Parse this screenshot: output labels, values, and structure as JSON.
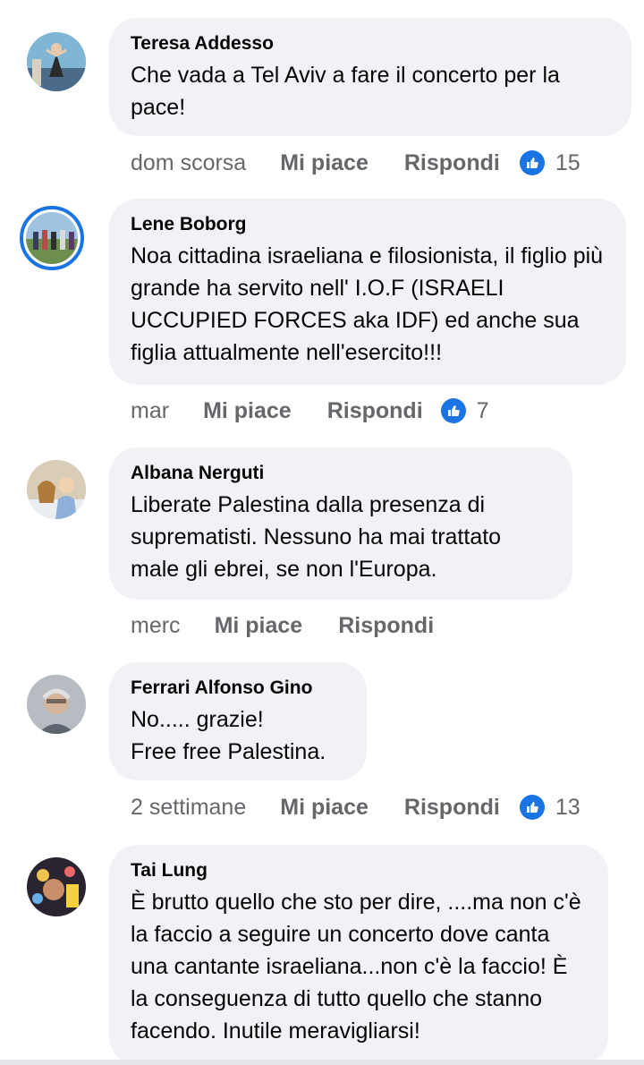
{
  "colors": {
    "bubble": "#f0f2f5",
    "meta_text": "#65676b",
    "like_blue": "#1b74e4"
  },
  "comments": [
    {
      "author": "Teresa Addesso",
      "text": "Che vada a Tel Aviv a fare il concerto per la pace!",
      "time": "dom scorsa",
      "like_label": "Mi piace",
      "reply_label": "Rispondi",
      "reaction_icon": "thumbs-up-icon",
      "reactions": "15"
    },
    {
      "author": "Lene Boborg",
      "text": "Noa cittadina israeliana e filosionista, il figlio più grande ha servito nell' I.O.F (ISRAELI UCCUPIED FORCES aka IDF) ed anche sua figlia attualmente nell'esercito!!!",
      "time": "mar",
      "like_label": "Mi piace",
      "reply_label": "Rispondi",
      "reaction_icon": "thumbs-up-icon",
      "reactions": "7"
    },
    {
      "author": "Albana Nerguti",
      "text": "Liberate Palestina dalla presenza di suprematisti. Nessuno ha mai trattato male gli ebrei, se non l'Europa.",
      "time": "merc",
      "like_label": "Mi piace",
      "reply_label": "Rispondi"
    },
    {
      "author": "Ferrari Alfonso Gino",
      "text": "No..... grazie!\nFree free Palestina.",
      "time": "2 settimane",
      "like_label": "Mi piace",
      "reply_label": "Rispondi",
      "reaction_icon": "thumbs-up-icon",
      "reactions": "13"
    },
    {
      "author": "Tai Lung",
      "text": "È brutto quello che sto per dire, ....ma non c'è la faccio a seguire un concerto dove canta una cantante israeliana...non c'è la faccio! È la conseguenza di tutto quello che stanno facendo. Inutile meravigliarsi!"
    }
  ]
}
